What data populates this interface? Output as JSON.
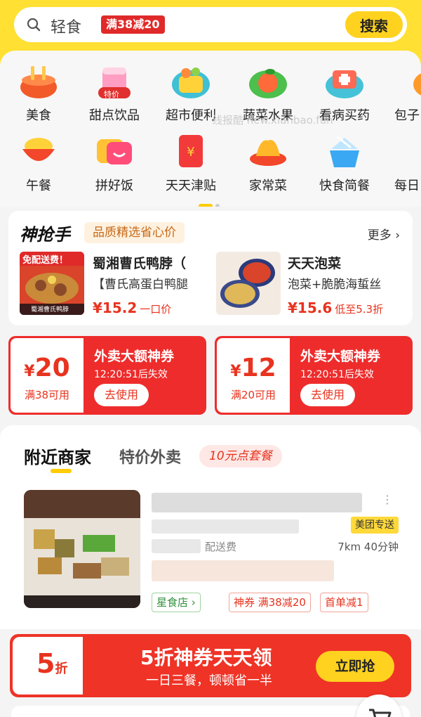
{
  "search": {
    "query": "轻食",
    "badge": "满38减20",
    "button": "搜索"
  },
  "categories_row1": [
    {
      "label": "美食",
      "icon": "food-bowl-icon"
    },
    {
      "label": "甜点饮品",
      "icon": "drink-cup-icon",
      "tag": "特价"
    },
    {
      "label": "超市便利",
      "icon": "basket-icon"
    },
    {
      "label": "蔬菜水果",
      "icon": "fruit-icon"
    },
    {
      "label": "看病买药",
      "icon": "medicine-box-icon"
    },
    {
      "label": "包子",
      "icon": "bun-icon"
    }
  ],
  "categories_row2": [
    {
      "label": "午餐",
      "icon": "rice-bowl-icon"
    },
    {
      "label": "拼好饭",
      "icon": "smile-bag-icon"
    },
    {
      "label": "天天津贴",
      "icon": "red-envelope-icon"
    },
    {
      "label": "家常菜",
      "icon": "dish-icon"
    },
    {
      "label": "快食简餐",
      "icon": "lunch-box-icon"
    },
    {
      "label": "每日",
      "icon": "daily-icon"
    }
  ],
  "watermark": "线报酷 new.xianbao.fun",
  "flash_sale": {
    "title": "神抢手",
    "subtitle": "品质精选省心价",
    "more": "更多 ›",
    "items": [
      {
        "image_text": "免配送费！",
        "image_brand": "蜀湘曹氏鸭脖",
        "name": "蜀湘曹氏鸭脖（",
        "desc": "【曹氏高蛋白鸭腿",
        "price": "¥15.2",
        "tag": "一口价"
      },
      {
        "image_text": "",
        "image_brand": "",
        "name": "天天泡菜",
        "desc": "泡菜+脆脆海蜇丝",
        "price": "¥15.6",
        "tag": "低至5.3折"
      }
    ]
  },
  "coupons": [
    {
      "currency": "¥",
      "amount": "20",
      "condition": "满38可用",
      "title": "外卖大额神券",
      "countdown": "12:20:51后失效",
      "button": "去使用"
    },
    {
      "currency": "¥",
      "amount": "12",
      "condition": "满20可用",
      "title": "外卖大额神券",
      "countdown": "12:20:51后失效",
      "button": "去使用"
    }
  ],
  "nearby": {
    "tab_active": "附近商家",
    "tab_second": "特价外卖",
    "tab_third": "10元点套餐",
    "store": {
      "badge": "美团专送",
      "delivery": "配送费",
      "distance": "7km 40分钟",
      "tags": [
        "星食店 ›",
        "神券 满38减20",
        "首单减1"
      ]
    }
  },
  "banner": {
    "number": "5",
    "unit": "折",
    "title": "5折神券天天领",
    "subtitle": "一日三餐，顿顿省一半",
    "button": "立即抢"
  },
  "colors": {
    "brand_yellow": "#ffe033",
    "accent_red": "#e8331e",
    "coupon_red": "#ee2c2c"
  }
}
